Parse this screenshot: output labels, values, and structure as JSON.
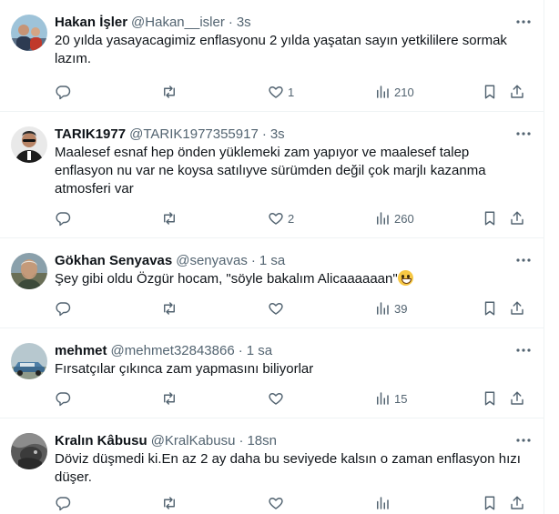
{
  "tweets": [
    {
      "name": "Hakan İşler",
      "handle": "@Hakan__isler",
      "time": "3s",
      "text": "20 yılda yasayacagimiz enflasyonu 2 yılda yaşatan sayın yetkililere sormak\nlazım.",
      "replies": "",
      "retweets": "",
      "likes": "1",
      "views": "210"
    },
    {
      "name": "TARIK1977",
      "handle": "@TARIK1977355917",
      "time": "3s",
      "text": "Maalesef esnaf hep önden yüklemeki zam yapıyor ve maalesef talep\nenflasyon nu var ne koysa satılıyve sürümden değil çok marjlı kazanma\natmosferi var",
      "replies": "",
      "retweets": "",
      "likes": "2",
      "views": "260"
    },
    {
      "name": "Gökhan Senyavas",
      "handle": "@senyavas",
      "time": "1 sa",
      "text": "Şey gibi oldu Özgür hocam, \"söyle bakalım Alicaaaaaan\"",
      "emoji": "grinning-face-emoji",
      "replies": "",
      "retweets": "",
      "likes": "",
      "views": "39"
    },
    {
      "name": "mehmet",
      "handle": "@mehmet32843866",
      "time": "1 sa",
      "text": "Fırsatçılar çıkınca zam yapmasını biliyorlar",
      "replies": "",
      "retweets": "",
      "likes": "",
      "views": "15"
    },
    {
      "name": "Kralın Kâbusu",
      "handle": "@KralKabusu",
      "time": "18sn",
      "text": "Döviz düşmedi ki.En az 2 ay daha bu seviyede kalsın o zaman enflasyon hızı\ndüşer.",
      "replies": "",
      "retweets": "",
      "likes": "",
      "views": ""
    }
  ],
  "separator": "·",
  "icons": {
    "more": "more-dots-icon",
    "reply": "reply-bubble-icon",
    "retweet": "retweet-icon",
    "like": "heart-icon",
    "views": "views-bar-icon",
    "bookmark": "bookmark-icon",
    "share": "share-icon"
  },
  "colors": {
    "text": "#0f1419",
    "secondary": "#536471",
    "divider": "#eff3f4",
    "background": "#ffffff"
  }
}
